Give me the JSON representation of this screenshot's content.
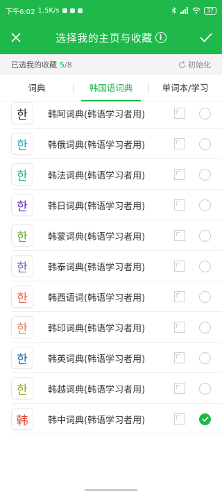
{
  "status_bar": {
    "time": "下午6:02",
    "speed": "1.5K/s",
    "battery": "37"
  },
  "header": {
    "title": "选择我的主页与收藏",
    "info_glyph": "i"
  },
  "selection": {
    "label": "已选我的收藏",
    "count": "5",
    "separator": "/",
    "total": "8",
    "reset_label": "初始化"
  },
  "tabs": [
    {
      "label": "词典"
    },
    {
      "label": "韩国语词典"
    },
    {
      "label": "单词本/学习"
    }
  ],
  "dictionaries": [
    {
      "glyph": "한",
      "color": "#222222",
      "name": "韩阿词典(韩语学习者用)",
      "checked": false
    },
    {
      "glyph": "한",
      "color": "#2aa7c9",
      "name": "韩俄词典(韩语学习者用)",
      "checked": false
    },
    {
      "glyph": "한",
      "color": "#1ea98a",
      "name": "韩法词典(韩语学习者用)",
      "checked": false
    },
    {
      "glyph": "한",
      "color": "#6a2bb8",
      "name": "韩日词典(韩语学习者用)",
      "checked": false
    },
    {
      "glyph": "한",
      "color": "#62a82d",
      "name": "韩蒙词典(韩语学习者用)",
      "checked": false
    },
    {
      "glyph": "한",
      "color": "#6c5fb0",
      "name": "韩泰词典(韩语学习者用)",
      "checked": false
    },
    {
      "glyph": "한",
      "color": "#e5675a",
      "name": "韩西语词(韩语学习者用)",
      "checked": false
    },
    {
      "glyph": "한",
      "color": "#e0784b",
      "name": "韩印词典(韩语学习者用)",
      "checked": false
    },
    {
      "glyph": "한",
      "color": "#1b6fb3",
      "name": "韩英词典(韩语学习者用)",
      "checked": false
    },
    {
      "glyph": "한",
      "color": "#8aab1c",
      "name": "韩越词典(韩语学习者用)",
      "checked": false
    },
    {
      "glyph": "韩",
      "color": "#d9442f",
      "name": "韩中词典(韩语学习者用)",
      "checked": true
    }
  ],
  "colors": {
    "brand": "#1fb84a"
  },
  "icons": {
    "close": "close-icon",
    "confirm": "check-icon",
    "reset": "refresh-icon",
    "home": "home-icon",
    "checked": "check-circle-icon"
  }
}
